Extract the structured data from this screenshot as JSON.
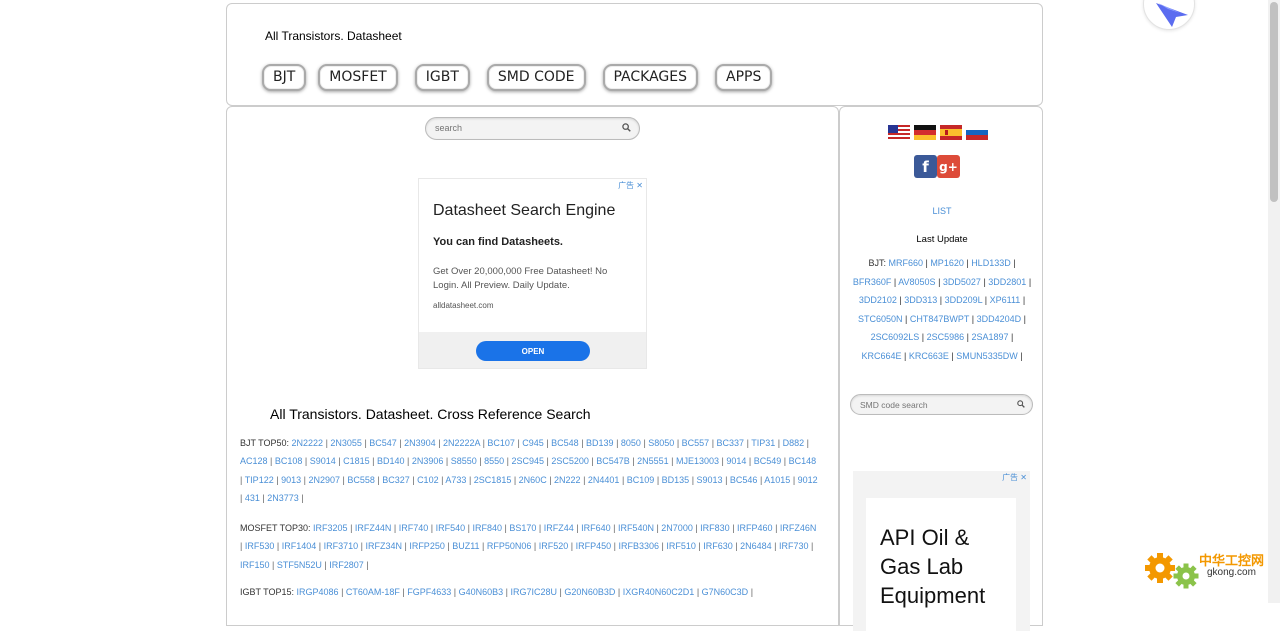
{
  "header": {
    "site_title": "All Transistors. Datasheet",
    "nav": [
      "BJT",
      "MOSFET",
      "IGBT",
      "SMD CODE",
      "PACKAGES",
      "APPS"
    ]
  },
  "search": {
    "placeholder": "search"
  },
  "ad": {
    "marks": "广告 ✕",
    "title": "Datasheet Search Engine",
    "subtitle": "You can find Datasheets.",
    "description": "Get Over 20,000,000 Free Datasheet! No Login. All Preview. Daily Update.",
    "url": "alldatasheet.com",
    "open_label": "OPEN"
  },
  "main": {
    "heading": "All Transistors. Datasheet. Cross Reference Search",
    "bjt": {
      "label": "BJT TOP50:",
      "items": [
        "2N2222",
        "2N3055",
        "BC547",
        "2N3904",
        "2N2222A",
        "BC107",
        "C945",
        "BC548",
        "BD139",
        "8050",
        "S8050",
        "BC557",
        "BC337",
        "TIP31",
        "D882",
        "AC128",
        "BC108",
        "S9014",
        "C1815",
        "BD140",
        "2N3906",
        "S8550",
        "8550",
        "2SC945",
        "2SC5200",
        "BC547B",
        "2N5551",
        "MJE13003",
        "9014",
        "BC549",
        "BC148",
        "TIP122",
        "9013",
        "2N2907",
        "BC558",
        "BC327",
        "C102",
        "A733",
        "2SC1815",
        "2N60C",
        "2N222",
        "2N4401",
        "BC109",
        "BD135",
        "S9013",
        "BC546",
        "A1015",
        "9012",
        "431",
        "2N3773"
      ]
    },
    "mosfet": {
      "label": "MOSFET TOP30:",
      "items": [
        "IRF3205",
        "IRFZ44N",
        "IRF740",
        "IRF540",
        "IRF840",
        "BS170",
        "IRFZ44",
        "IRF640",
        "IRF540N",
        "2N7000",
        "IRF830",
        "IRFP460",
        "IRFZ46N",
        "IRF530",
        "IRF1404",
        "IRF3710",
        "IRFZ34N",
        "IRFP250",
        "BUZ11",
        "RFP50N06",
        "IRF520",
        "IRFP450",
        "IRFB3306",
        "IRF510",
        "IRF630",
        "2N6484",
        "IRF730",
        "IRF150",
        "STF5N52U",
        "IRF2807"
      ]
    },
    "igbt": {
      "label": "IGBT TOP15:",
      "items": [
        "IRGP4086",
        "CT60AM-18F",
        "FGPF4633",
        "G40N60B3",
        "IRG7IC28U",
        "G20N60B3D",
        "IXGR40N60C2D1",
        "G7N60C3D"
      ]
    }
  },
  "sidebar": {
    "flags": [
      "us-flag-icon",
      "de-flag-icon",
      "es-flag-icon",
      "ru-flag-icon"
    ],
    "social": [
      "f",
      "g+"
    ],
    "list_link": "LIST",
    "last_update_title": "Last Update",
    "recent_label": "BJT:",
    "recent": [
      "MRF660",
      "MP1620",
      "HLD133D",
      "BFR360F",
      "AV8050S",
      "3DD5027",
      "3DD2801",
      "3DD2102",
      "3DD313",
      "3DD209L",
      "XP6111",
      "STC6050N",
      "CHT847BWPT",
      "3DD4204D",
      "2SC6092LS",
      "2SC5986",
      "2SA1897",
      "KRC664E",
      "KRC663E",
      "SMUN5335DW"
    ],
    "smd_placeholder": "SMD code search"
  },
  "ad2": {
    "marks": "广告 ✕",
    "title": "API Oil & Gas Lab Equipment"
  },
  "watermark": {
    "cn": "中华工控网",
    "en": "gkong.com"
  },
  "colors": {
    "link": "#4a8fd6",
    "border": "#cccccc",
    "ad_button": "#1a73e8",
    "watermark": "#f39800"
  }
}
